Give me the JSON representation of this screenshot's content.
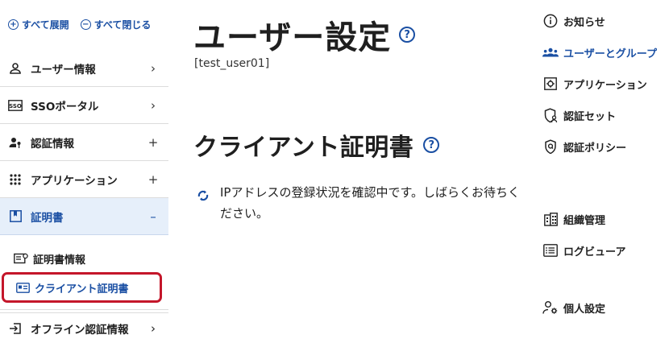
{
  "sidebar": {
    "expand_all": "すべて展開",
    "collapse_all": "すべて閉じる",
    "items": [
      {
        "label": "ユーザー情報",
        "toggle": "›"
      },
      {
        "label": "SSOポータル",
        "toggle": "›"
      },
      {
        "label": "認証情報",
        "toggle": "+"
      },
      {
        "label": "アプリケーション",
        "toggle": "+"
      },
      {
        "label": "証明書",
        "toggle": "–"
      }
    ],
    "sub_items": [
      {
        "label": "証明書情報"
      },
      {
        "label": "クライアント証明書"
      }
    ],
    "bottom_item": {
      "label": "オフライン認証情報",
      "toggle": "›"
    }
  },
  "main": {
    "page_title": "ユーザー設定",
    "user_id": "[test_user01]",
    "section_title": "クライアント証明書",
    "status_text": "IPアドレスの登録状況を確認中です。しばらくお待ちください。"
  },
  "right_nav": {
    "items": [
      {
        "label": "お知らせ"
      },
      {
        "label": "ユーザーとグループ"
      },
      {
        "label": "アプリケーション"
      },
      {
        "label": "認証セット"
      },
      {
        "label": "認証ポリシー"
      },
      {
        "label": "組織管理"
      },
      {
        "label": "ログビューア"
      },
      {
        "label": "個人設定"
      }
    ]
  },
  "colors": {
    "accent": "#1a4fa3",
    "active_bg": "#e6effa",
    "highlight_border": "#c4162a"
  }
}
